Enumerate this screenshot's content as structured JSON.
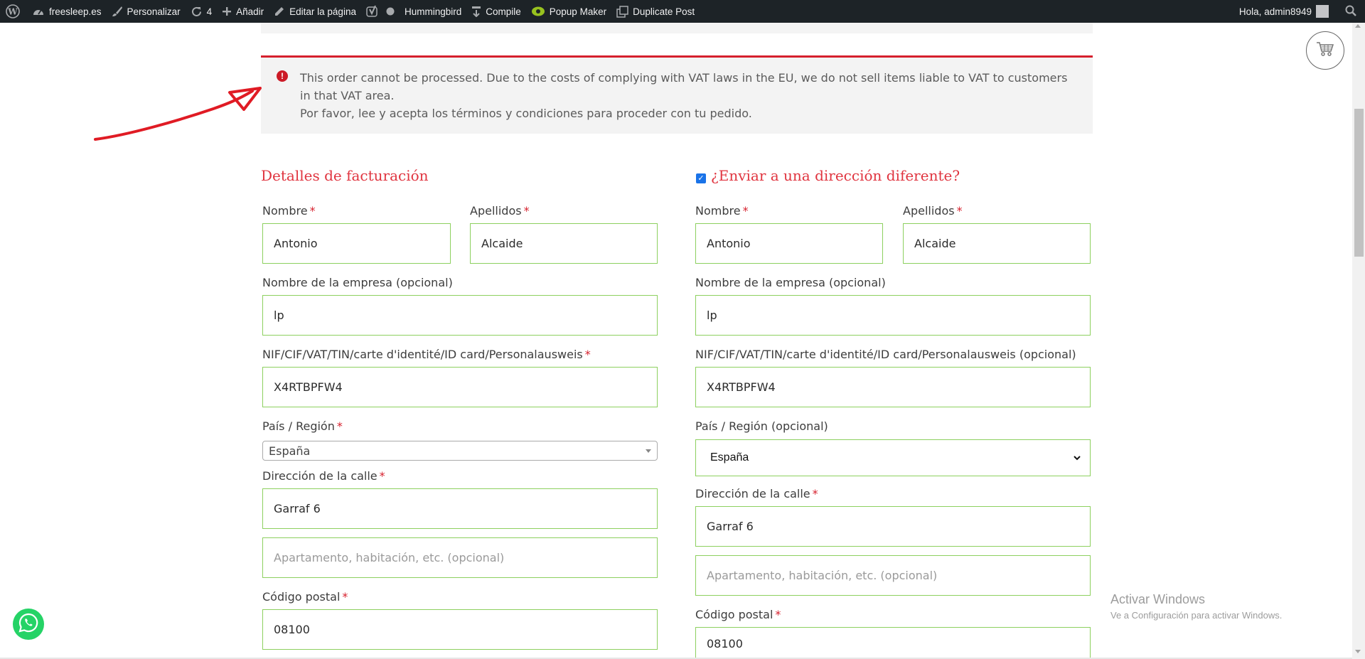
{
  "admin_bar": {
    "site_name": "freesleep.es",
    "customize": "Personalizar",
    "updates_count": "4",
    "add_new": "Añadir",
    "edit_page": "Editar la página",
    "hummingbird": "Hummingbird",
    "compile": "Compile",
    "popup_maker": "Popup Maker",
    "duplicate_post": "Duplicate Post",
    "greeting": "Hola, admin8949"
  },
  "notice": {
    "line1": "This order cannot be processed. Due to the costs of complying with VAT laws in the EU, we do not sell items liable to VAT to customers in that VAT area.",
    "line2": "Por favor, lee y acepta los términos y condiciones para proceder con tu pedido."
  },
  "billing": {
    "heading": "Detalles de facturación",
    "first_name_label": "Nombre",
    "first_name": "Antonio",
    "last_name_label": "Apellidos",
    "last_name": "Alcaide",
    "company_label": "Nombre de la empresa (opcional)",
    "company": "lp",
    "vat_label": "NIF/CIF/VAT/TIN/carte d'identité/ID card/Personalausweis",
    "vat": "X4RTBPFW4",
    "country_label": "País / Región",
    "country": "España",
    "address_label": "Dirección de la calle",
    "address1": "Garraf 6",
    "address2_placeholder": "Apartamento, habitación, etc. (opcional)",
    "postcode_label": "Código postal",
    "postcode": "08100"
  },
  "shipping": {
    "heading": "¿Enviar a una dirección diferente?",
    "checkbox_checked": true,
    "first_name_label": "Nombre",
    "first_name": "Antonio",
    "last_name_label": "Apellidos",
    "last_name": "Alcaide",
    "company_label": "Nombre de la empresa (opcional)",
    "company": "lp",
    "vat_label": "NIF/CIF/VAT/TIN/carte d'identité/ID card/Personalausweis (opcional)",
    "vat": "X4RTBPFW4",
    "country_label": "País / Región (opcional)",
    "country": "España",
    "address_label": "Dirección de la calle",
    "address1": "Garraf 6",
    "address2_placeholder": "Apartamento, habitación, etc. (opcional)",
    "postcode_label": "Código postal",
    "postcode": "08100"
  },
  "required_mark": "*",
  "watermark": {
    "title": "Activar Windows",
    "subtitle": "Ve a Configuración para activar Windows."
  },
  "colors": {
    "accent_red": "#e0343f",
    "field_border": "#8dd05f",
    "admin_bar_bg": "#1d2327",
    "annotation_red": "#e01b24"
  },
  "icons": [
    "wordpress-icon",
    "dashboard-icon",
    "brush-icon",
    "update-icon",
    "plus-icon",
    "pencil-icon",
    "yoast-icon",
    "status-dot-icon",
    "compile-icon",
    "popup-maker-icon",
    "duplicate-icon",
    "search-icon",
    "cart-icon",
    "error-icon",
    "whatsapp-icon"
  ]
}
